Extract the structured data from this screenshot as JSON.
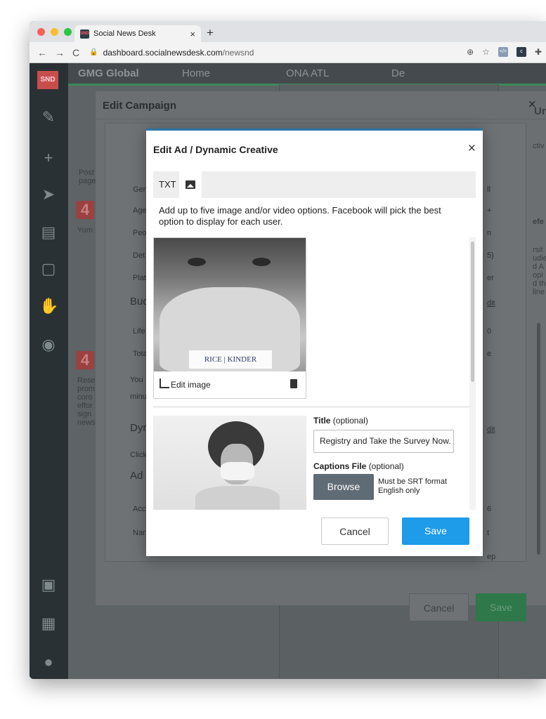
{
  "browser": {
    "tab_title": "Social News Desk",
    "tab_favicon": "SND",
    "tab_close": "×",
    "new_tab": "+",
    "url_domain": "dashboard.socialnewsdesk.com",
    "url_path": "/newsnd",
    "back": "←",
    "forward": "→",
    "reload": "C"
  },
  "app": {
    "logo": "SND",
    "topbar": {
      "group": "GMG Global",
      "home": "Home",
      "ona": "ONA ATL",
      "de": "De"
    },
    "bg_panel_texts": [
      "Gen",
      "Age",
      "Peo",
      "Det",
      "Plat",
      "Bud",
      "Life",
      "Tota",
      "You",
      "minu",
      "Dyr",
      "Click",
      "Ad",
      "Acc",
      "Nar"
    ],
    "bg_left_texts": [
      "Post",
      "page",
      "Yum",
      "Rese",
      "prom",
      "coro",
      "effor",
      "sign",
      "news"
    ],
    "bg_right_texts": [
      "ll",
      "+",
      "n",
      "5)",
      "er",
      "dit",
      "0",
      "e",
      "dit",
      "6",
      "t",
      "ep"
    ],
    "far_right_texts": [
      "Uni",
      "ctiv",
      "efe",
      "rsit",
      "udie",
      "d A",
      "opi",
      "d th",
      "line"
    ]
  },
  "campaign_modal": {
    "title": "Edit Campaign",
    "close": "×",
    "cancel": "Cancel",
    "save": "Save"
  },
  "ad_modal": {
    "title": "Edit Ad / Dynamic Creative",
    "close": "×",
    "tab_txt": "TXT",
    "description": "Add up to five image and/or video options. Facebook will pick the best option to display for each user.",
    "card1": {
      "logo_text": "RICE | KINDER",
      "edit_image": "Edit image"
    },
    "card2": {
      "title_label_bold": "Title",
      "title_label_rest": " (optional)",
      "title_value": "Registry and Take the Survey Now.",
      "captions_label_bold": "Captions File",
      "captions_label_rest": " (optional)",
      "browse": "Browse",
      "srt_note_line1": "Must be SRT format",
      "srt_note_line2": "English only"
    },
    "cancel": "Cancel",
    "save": "Save"
  },
  "colors": {
    "accent_blue": "#1e9be9",
    "modal_border": "#2a75a8",
    "browse_gray": "#5f6b75",
    "save_green": "#2e7849"
  },
  "icons": [
    "search-icon",
    "star-icon",
    "extension-icon",
    "image-icon",
    "crop-icon",
    "trash-icon",
    "close-icon"
  ]
}
